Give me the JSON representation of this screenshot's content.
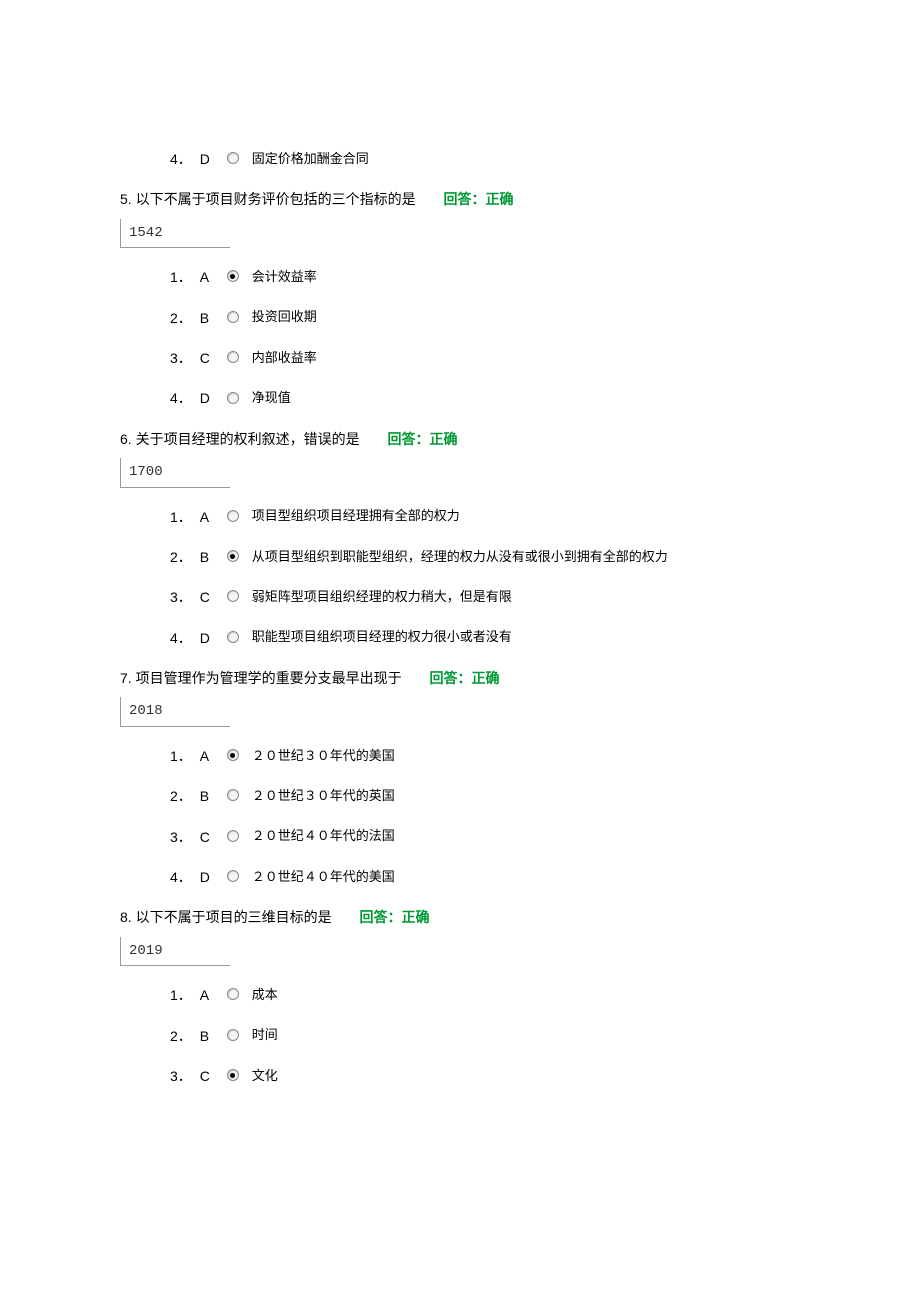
{
  "q4_partial": {
    "options": [
      {
        "num": "4．",
        "letter": "D",
        "text": "固定价格加酬金合同",
        "selected": false
      }
    ]
  },
  "q5": {
    "num": "5.",
    "text": "以下不属于项目财务评价包括的三个指标的是",
    "status": "回答：正确",
    "code": "1542",
    "options": [
      {
        "num": "1．",
        "letter": "A",
        "text": "会计效益率",
        "selected": true
      },
      {
        "num": "2．",
        "letter": "B",
        "text": "投资回收期",
        "selected": false
      },
      {
        "num": "3．",
        "letter": "C",
        "text": "内部收益率",
        "selected": false
      },
      {
        "num": "4．",
        "letter": "D",
        "text": "净现值",
        "selected": false
      }
    ]
  },
  "q6": {
    "num": "6.",
    "text": "关于项目经理的权利叙述，错误的是",
    "status": "回答：正确",
    "code": "1700",
    "options": [
      {
        "num": "1．",
        "letter": "A",
        "text": "项目型组织项目经理拥有全部的权力",
        "selected": false
      },
      {
        "num": "2．",
        "letter": "B",
        "text": "从项目型组织到职能型组织，经理的权力从没有或很小到拥有全部的权力",
        "selected": true
      },
      {
        "num": "3．",
        "letter": "C",
        "text": "弱矩阵型项目组织经理的权力稍大，但是有限",
        "selected": false
      },
      {
        "num": "4．",
        "letter": "D",
        "text": "职能型项目组织项目经理的权力很小或者没有",
        "selected": false
      }
    ]
  },
  "q7": {
    "num": "7.",
    "text": "项目管理作为管理学的重要分支最早出现于",
    "status": "回答：正确",
    "code": "2018",
    "options": [
      {
        "num": "1．",
        "letter": "A",
        "text": "２０世纪３０年代的美国",
        "selected": true
      },
      {
        "num": "2．",
        "letter": "B",
        "text": "２０世纪３０年代的英国",
        "selected": false
      },
      {
        "num": "3．",
        "letter": "C",
        "text": "２０世纪４０年代的法国",
        "selected": false
      },
      {
        "num": "4．",
        "letter": "D",
        "text": "２０世纪４０年代的美国",
        "selected": false
      }
    ]
  },
  "q8": {
    "num": "8.",
    "text": "以下不属于项目的三维目标的是",
    "status": "回答：正确",
    "code": "2019",
    "options": [
      {
        "num": "1．",
        "letter": "A",
        "text": "成本",
        "selected": false
      },
      {
        "num": "2．",
        "letter": "B",
        "text": "时间",
        "selected": false
      },
      {
        "num": "3．",
        "letter": "C",
        "text": "文化",
        "selected": true
      }
    ]
  }
}
